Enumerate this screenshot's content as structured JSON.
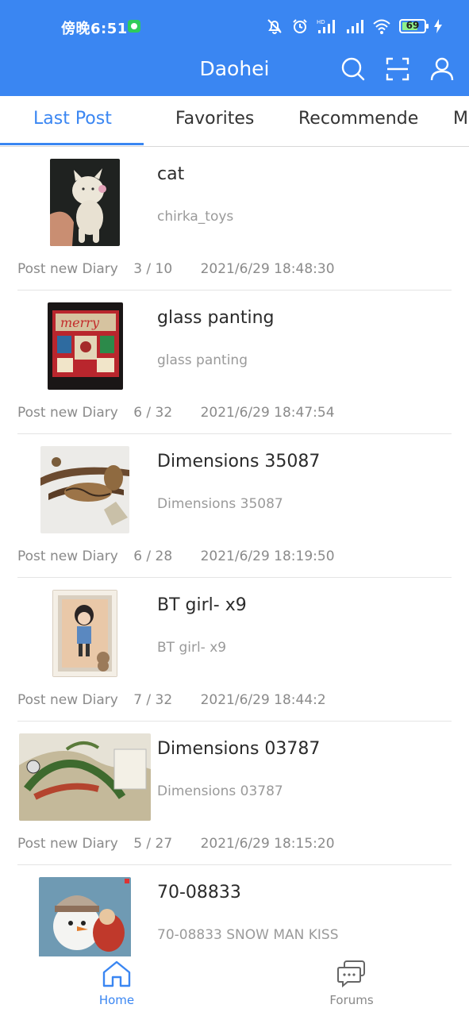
{
  "status_bar": {
    "time": "傍晚6:51",
    "battery": "69"
  },
  "app_bar": {
    "title": "Daohei"
  },
  "icons": {
    "search": "search-icon",
    "scan": "scan-icon",
    "profile": "user-icon",
    "home": "home-icon",
    "forums": "chat-icon"
  },
  "colors": {
    "primary": "#3a86f2",
    "text": "#2b2b2b",
    "muted": "#9a9a9a"
  },
  "tabs": [
    {
      "label": "Last Post"
    },
    {
      "label": "Favorites"
    },
    {
      "label": "Recommende"
    },
    {
      "label": "M"
    }
  ],
  "posts": [
    {
      "title": "cat",
      "subtitle": "chirka_toys",
      "action": "Post new Diary",
      "count": "3 / 10",
      "timestamp": "2021/6/29 18:48:30"
    },
    {
      "title": "glass panting",
      "subtitle": "glass panting",
      "action": "Post new Diary",
      "count": "6 / 32",
      "timestamp": "2021/6/29 18:47:54"
    },
    {
      "title": "Dimensions 35087",
      "subtitle": "Dimensions 35087",
      "action": "Post new Diary",
      "count": "6 / 28",
      "timestamp": "2021/6/29 18:19:50"
    },
    {
      "title": "BT girl- x9",
      "subtitle": "BT girl- x9",
      "action": "Post new Diary",
      "count": "7 / 32",
      "timestamp": "2021/6/29 18:44:2"
    },
    {
      "title": "Dimensions 03787",
      "subtitle": "Dimensions 03787",
      "action": "Post new Diary",
      "count": "5 / 27",
      "timestamp": "2021/6/29 18:15:20"
    },
    {
      "title": "70-08833",
      "subtitle": "70-08833 SNOW MAN KISS",
      "action": "",
      "count": "",
      "timestamp": ""
    }
  ],
  "thumb_text": {
    "merry": "merry"
  },
  "bottom_nav": {
    "home": "Home",
    "forums": "Forums"
  }
}
